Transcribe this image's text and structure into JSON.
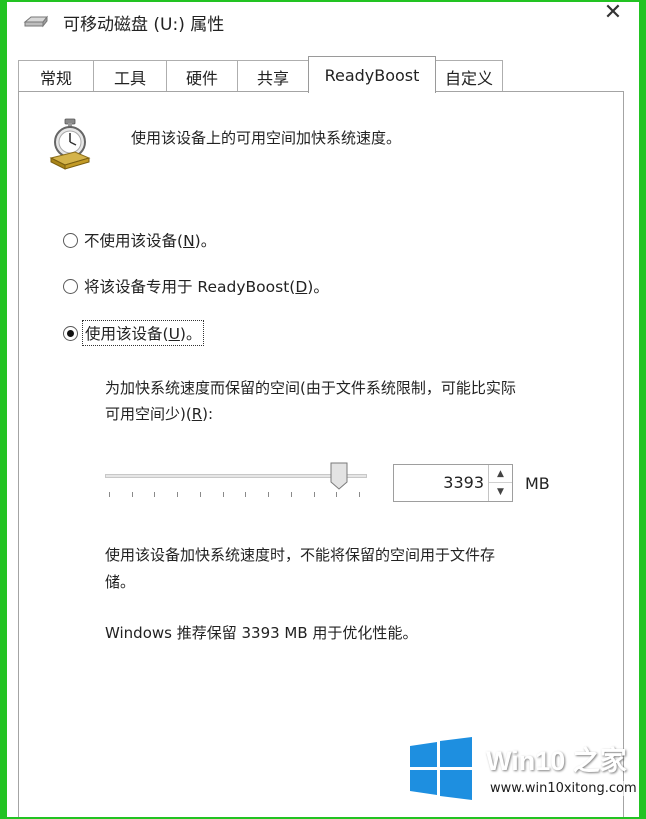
{
  "window": {
    "title": "可移动磁盘 (U:) 属性",
    "close_glyph": "✕"
  },
  "tabs": [
    {
      "label": "常规",
      "active": false
    },
    {
      "label": "工具",
      "active": false
    },
    {
      "label": "硬件",
      "active": false
    },
    {
      "label": "共享",
      "active": false
    },
    {
      "label": "ReadyBoost",
      "active": true
    },
    {
      "label": "自定义",
      "active": false
    }
  ],
  "panel": {
    "intro": "使用该设备上的可用空间加快系统速度。",
    "icon": "stopwatch-icon",
    "options": [
      {
        "pre": "不使用该设备(",
        "key": "N",
        "post": ")。",
        "checked": false
      },
      {
        "pre": "将该设备专用于 ReadyBoost(",
        "key": "D",
        "post": ")。",
        "checked": false
      },
      {
        "pre": "使用该设备(",
        "key": "U",
        "post": ")。",
        "checked": true
      }
    ],
    "reserve_label_line1": "为加快系统速度而保留的空间(由于文件系统限制，可能比实际",
    "reserve_label_line2_pre": "可用空间少)(",
    "reserve_label_key": "R",
    "reserve_label_line2_post": "):",
    "slider_fraction": 0.92,
    "reserve_value": "3393",
    "reserve_unit": "MB",
    "note_line1": "使用该设备加快系统速度时，不能将保留的空间用于文件存",
    "note_line2": "储。",
    "recommendation": "Windows 推荐保留 3393 MB 用于优化性能。"
  },
  "watermark": {
    "title": "Win10 之家",
    "url": "www.win10xitong.com"
  },
  "colors": {
    "frame_border": "#22c322",
    "win_logo_blue": "#1e8fe0"
  }
}
